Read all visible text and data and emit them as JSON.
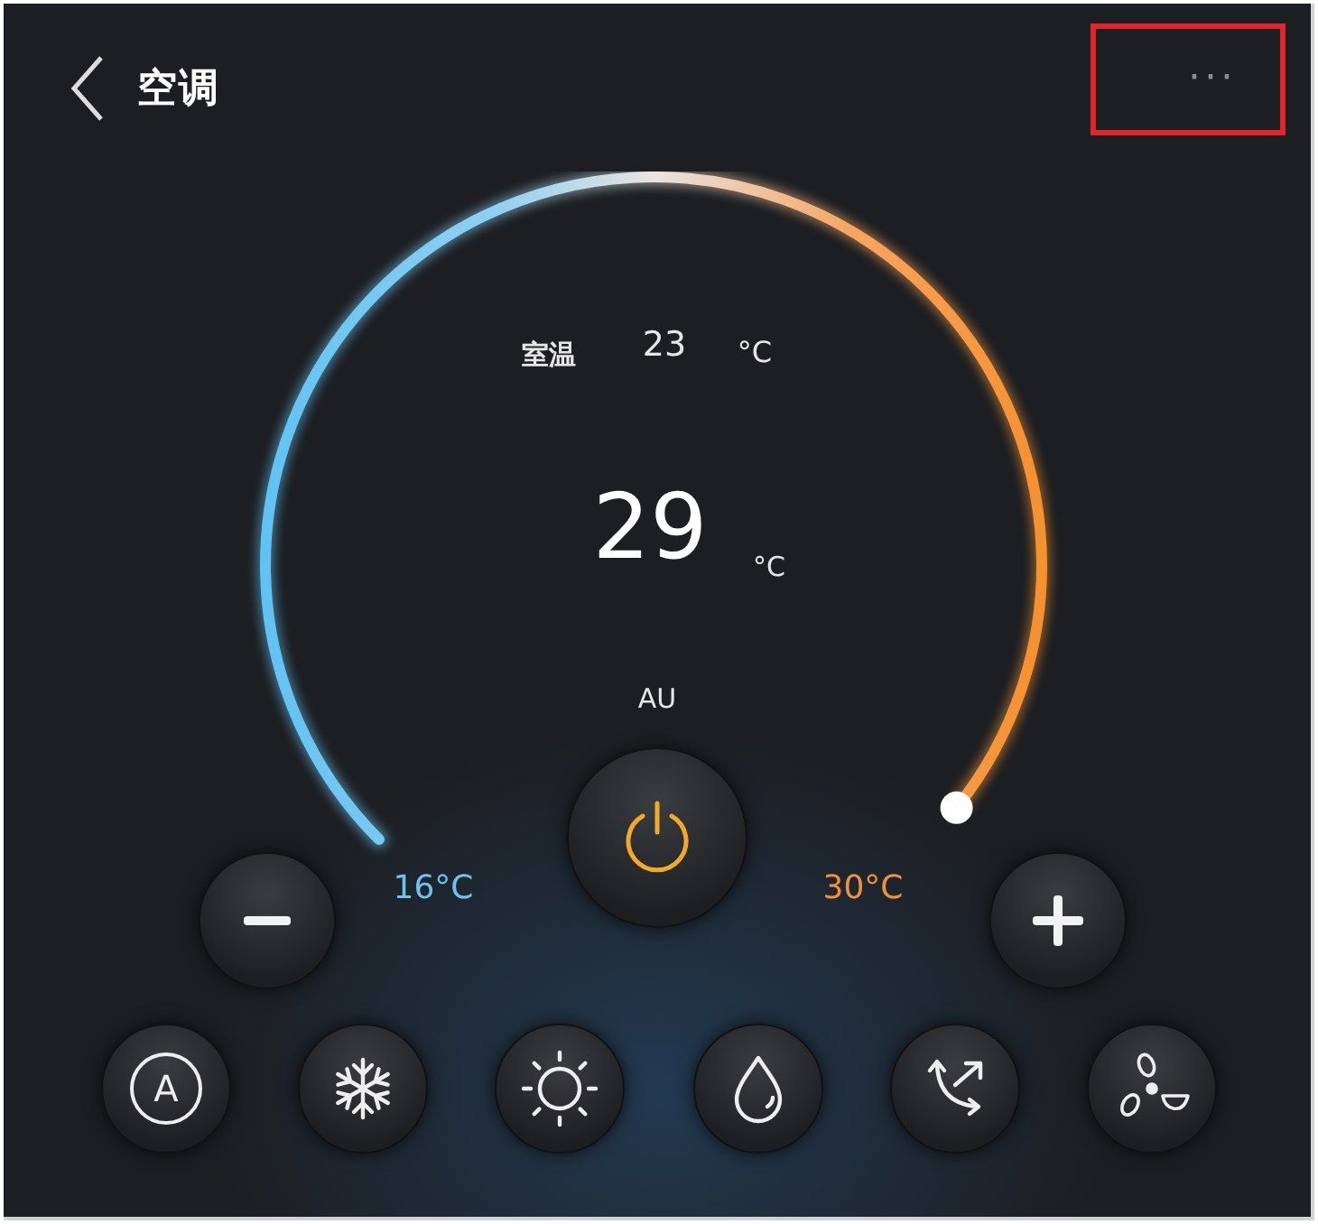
{
  "header": {
    "title": "空调",
    "more": {
      "label": "···",
      "highlighted": true
    }
  },
  "dial": {
    "room_label": "室温",
    "room_value": "23",
    "room_unit": "°C",
    "set_value": "29",
    "set_unit": "°C",
    "mode_label": "AU",
    "min_label": "16°C",
    "max_label": "30°C",
    "power_on": true
  },
  "modes": [
    {
      "kind": "auto",
      "label": "A"
    },
    {
      "kind": "cool"
    },
    {
      "kind": "heat"
    },
    {
      "kind": "dry"
    },
    {
      "kind": "swing"
    },
    {
      "kind": "fan"
    }
  ]
}
